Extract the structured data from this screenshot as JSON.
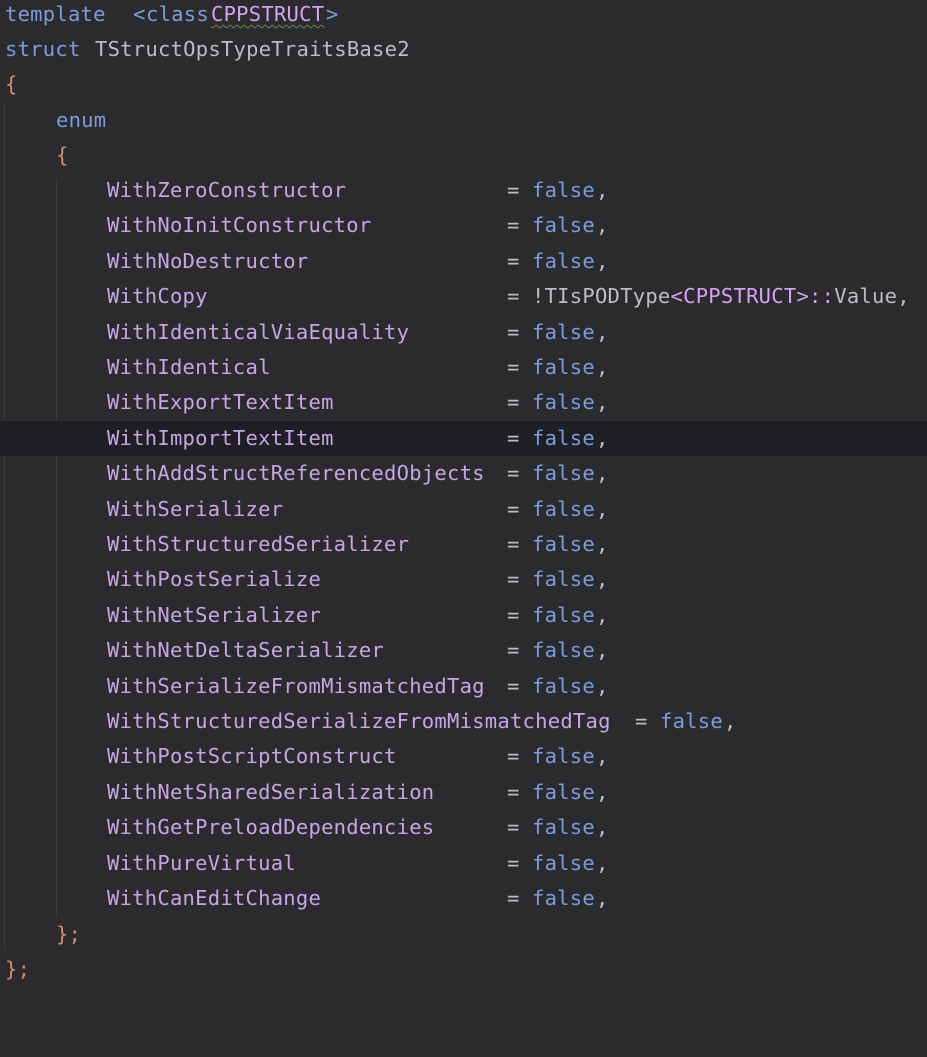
{
  "code": {
    "template_kw": "template",
    "template_open": "<",
    "class_kw": "class",
    "template_param": "CPPSTRUCT",
    "template_close": ">",
    "struct_kw": "struct",
    "struct_name": "TStructOpsTypeTraitsBase2",
    "open_brace": "{",
    "enum_kw": "enum",
    "enum_open_brace": "{",
    "enum_close": "};",
    "struct_close": "};",
    "assign": "=",
    "false_value": "false",
    "comma": ",",
    "members": [
      {
        "name": "WithZeroConstructor",
        "value": "false"
      },
      {
        "name": "WithNoInitConstructor",
        "value": "false"
      },
      {
        "name": "WithNoDestructor",
        "value": "false"
      },
      {
        "name": "WithCopy",
        "value": "!TIsPODType<CPPSTRUCT>::Value"
      },
      {
        "name": "WithIdenticalViaEquality",
        "value": "false"
      },
      {
        "name": "WithIdentical",
        "value": "false"
      },
      {
        "name": "WithExportTextItem",
        "value": "false"
      },
      {
        "name": "WithImportTextItem",
        "value": "false"
      },
      {
        "name": "WithAddStructReferencedObjects",
        "value": "false"
      },
      {
        "name": "WithSerializer",
        "value": "false"
      },
      {
        "name": "WithStructuredSerializer",
        "value": "false"
      },
      {
        "name": "WithPostSerialize",
        "value": "false"
      },
      {
        "name": "WithNetSerializer",
        "value": "false"
      },
      {
        "name": "WithNetDeltaSerializer",
        "value": "false"
      },
      {
        "name": "WithSerializeFromMismatchedTag",
        "value": "false"
      },
      {
        "name": "WithStructuredSerializeFromMismatchedTag",
        "value": "false"
      },
      {
        "name": "WithPostScriptConstruct",
        "value": "false"
      },
      {
        "name": "WithNetSharedSerialization",
        "value": "false"
      },
      {
        "name": "WithGetPreloadDependencies",
        "value": "false"
      },
      {
        "name": "WithPureVirtual",
        "value": "false"
      },
      {
        "name": "WithCanEditChange",
        "value": "false"
      }
    ],
    "copy_value_parts": {
      "not_op": "!",
      "trait_name": "TIsPODType",
      "lt": "<",
      "param": "CPPSTRUCT",
      "gt_scope": ">::",
      "member": "Value"
    },
    "current_line_member": "WithImportTextItem"
  },
  "colors": {
    "background": "#2b2b2d",
    "current_line": "#1e1f22",
    "keyword": "#cf8e6d",
    "keyword_blue": "#7b9ddd",
    "identifier": "#bcbec4",
    "enum_member": "#c7a6e8",
    "template_param": "#d5a2f5"
  }
}
